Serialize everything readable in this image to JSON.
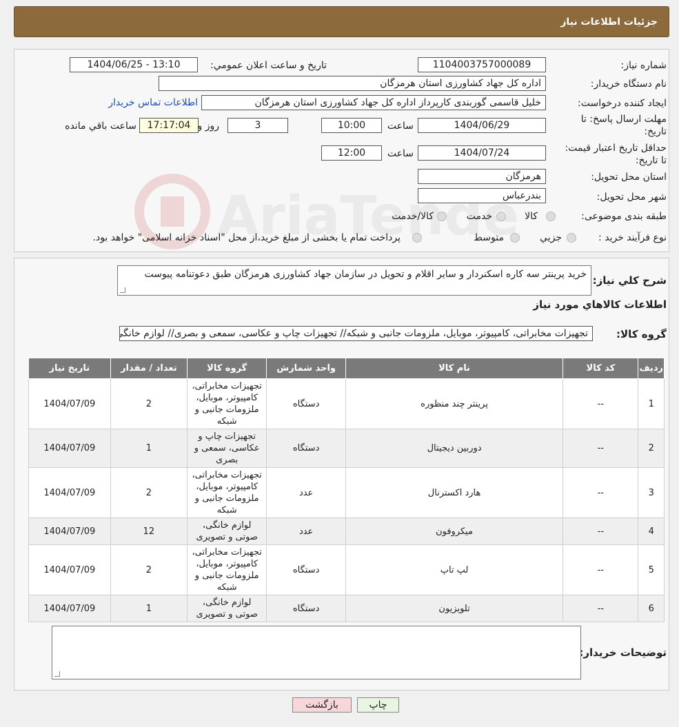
{
  "header": {
    "title": "جزئیات اطلاعات نیاز"
  },
  "details": {
    "need_number_label": "شماره نیاز:",
    "need_number": "1104003757000089",
    "announce_label": "تاریخ و ساعت اعلان عمومي:",
    "announce_value": "1404/06/25 - 13:10",
    "buyer_org_label": "نام دستگاه خریدار:",
    "buyer_org": "اداره کل جهاد کشاورزی استان هرمزگان",
    "creator_label": "ایجاد کننده درخواست:",
    "creator": "خلیل قاسمی گوربندی کارپرداز اداره کل جهاد کشاورزی استان هرمزگان",
    "contact_link": "اطلاعات تماس خریدار",
    "deadline_label": "مهلت ارسال پاسخ: تا تاریخ:",
    "deadline_date": "1404/06/29",
    "time_label": "ساعت",
    "deadline_time": "10:00",
    "days_value": "3",
    "days_label": "روز و",
    "remaining_time": "17:17:04",
    "remaining_label": "ساعت باقي مانده",
    "validity_label": "حداقل تاریخ اعتبار قیمت: تا تاریخ:",
    "validity_date": "1404/07/24",
    "validity_time": "12:00",
    "province_label": "استان محل تحویل:",
    "province": "هرمزگان",
    "city_label": "شهر محل تحویل:",
    "city": "بندرعباس",
    "category_label": "طبقه بندی موضوعی:",
    "category_options": [
      "کالا",
      "خدمت",
      "کالا/خدمت"
    ],
    "process_label": "نوع فرآیند خرید :",
    "process_options": [
      "جزیي",
      "متوسط"
    ],
    "process_note": "پرداخت تمام یا بخشی از مبلغ خرید،از محل \"اسناد خزانه اسلامی\" خواهد بود."
  },
  "summary": {
    "desc_label": "شرح كلي نياز:",
    "desc_value": "خرید پرینتر سه کاره اسکنردار و سایر اقلام  و تحویل در سازمان جهاد کشاورزی هرمزگان طبق دعوتنامه پیوست",
    "goods_info_title": "اطلاعات كالاهاي مورد نياز",
    "group_label": "گروه کالا:",
    "group_value": "تجهیزات مخابراتی، کامپیوتر، موبایل، ملزومات جانبی و شبکه// تجهیزات چاپ و عکاسی، سمعی و بصری// لوازم خانگی، صوتی و تصویری"
  },
  "table": {
    "headers": [
      "ردیف",
      "کد کالا",
      "نام کالا",
      "واحد شمارش",
      "گروه کالا",
      "تعداد / مقدار",
      "تاریخ نیاز"
    ],
    "rows": [
      [
        "1",
        "--",
        "پرینتر چند منظوره",
        "دستگاه",
        "تجهیزات مخابراتی، کامپیوتر، موبایل، ملزومات جانبی و شبکه",
        "2",
        "1404/07/09"
      ],
      [
        "2",
        "--",
        "دوربین دیجیتال",
        "دستگاه",
        "تجهیزات چاپ و عکاسی، سمعی و بصری",
        "1",
        "1404/07/09"
      ],
      [
        "3",
        "--",
        "هارد اکسترنال",
        "عدد",
        "تجهیزات مخابراتی، کامپیوتر، موبایل، ملزومات جانبی و شبکه",
        "2",
        "1404/07/09"
      ],
      [
        "4",
        "--",
        "میکروفون",
        "عدد",
        "لوازم خانگی، صوتی و تصویری",
        "12",
        "1404/07/09"
      ],
      [
        "5",
        "--",
        "لپ تاپ",
        "دستگاه",
        "تجهیزات مخابراتی، کامپیوتر، موبایل، ملزومات جانبی و شبکه",
        "2",
        "1404/07/09"
      ],
      [
        "6",
        "--",
        "تلویزیون",
        "دستگاه",
        "لوازم خانگی، صوتی و تصویری",
        "1",
        "1404/07/09"
      ]
    ]
  },
  "notes": {
    "label": "توضیحات خریدار:",
    "value": ""
  },
  "buttons": {
    "print": "چاپ",
    "back": "بازگشت"
  },
  "watermark": {
    "text": "AriaTender.neT"
  },
  "colors": {
    "header_bg": "#8c6a3c",
    "table_header_bg": "#7a7a7a",
    "link": "#1a4fb5",
    "back_btn_bg": "#f8d7da",
    "print_btn_bg": "#e8f5e0"
  },
  "icons": [
    "radio-icon",
    "resize-grip-icon",
    "watermark-logo-icon"
  ]
}
